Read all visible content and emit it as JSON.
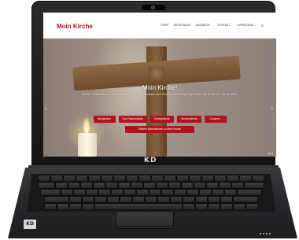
{
  "device": {
    "lid_brand": "KD",
    "base_badge": "KD"
  },
  "site": {
    "logo": "Moin Kirche",
    "nav": [
      "START",
      "BEGEGNUNG",
      "ANGEBOTE ⌄",
      "KONTAKT ⌄",
      "IMPRESSUM ⌄"
    ],
    "search_icon": "search-icon"
  },
  "hero": {
    "title": "Moin Kirche!",
    "subtitle": "Herzlich willkommen bei der Evangelischen Kirchengemeinde, dem Kirchenkreis und Sprengel Wesel. Wir freuen uns, Sie zu sehen.",
    "buttons": [
      "Neuigkeiten",
      "Das Pastorenteam",
      "Gottesdienste",
      "Gemeindebrief",
      "Gruppen"
    ],
    "wide_button": "Weitere Informationen zu Moin Kirche!",
    "arrow_left": "‹",
    "arrow_right": "›"
  },
  "colors": {
    "brand": "#b3121d",
    "nav_text": "#333333"
  }
}
